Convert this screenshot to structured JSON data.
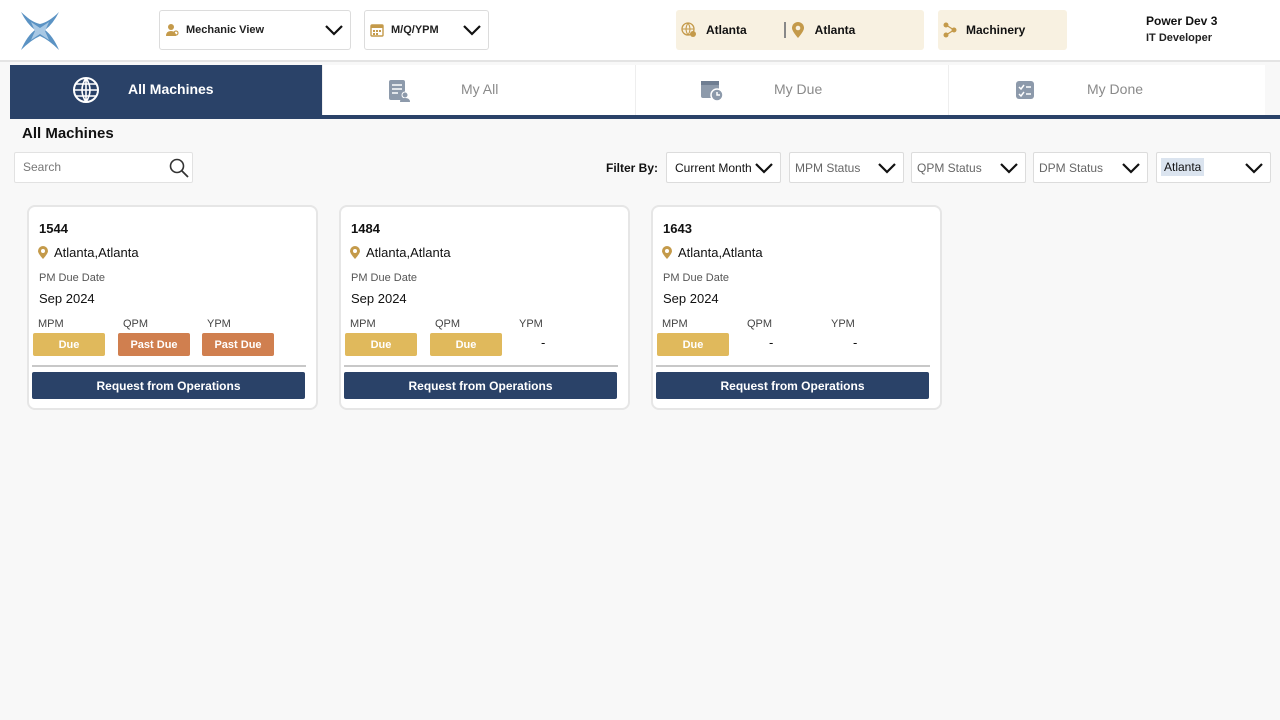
{
  "header": {
    "view_select": "Mechanic View",
    "period_select": "M/Q/YPM",
    "location": {
      "region": "Atlanta",
      "site": "Atlanta"
    },
    "category": "Machinery",
    "user": {
      "name": "Power Dev 3",
      "role": "IT Developer"
    }
  },
  "tabs": [
    {
      "label": "All Machines",
      "icon": "globe-icon",
      "active": true
    },
    {
      "label": "My All",
      "icon": "checklist-user-icon",
      "active": false
    },
    {
      "label": "My Due",
      "icon": "calendar-clock-icon",
      "active": false
    },
    {
      "label": "My Done",
      "icon": "checklist-done-icon",
      "active": false
    }
  ],
  "page_title": "All Machines",
  "search": {
    "placeholder": "Search",
    "value": ""
  },
  "filters": {
    "label": "Filter By:",
    "period": "Current Month",
    "mpm": "MPM Status",
    "qpm": "QPM Status",
    "dpm": "DPM Status",
    "location": "Atlanta"
  },
  "cards": [
    {
      "id": "1544",
      "location": "Atlanta,Atlanta",
      "due_label": "PM Due Date",
      "due_value": "Sep 2024",
      "statuses": [
        {
          "label": "MPM",
          "value": "Due"
        },
        {
          "label": "QPM",
          "value": "Past Due"
        },
        {
          "label": "YPM",
          "value": "Past Due"
        }
      ],
      "action": "Request from Operations"
    },
    {
      "id": "1484",
      "location": "Atlanta,Atlanta",
      "due_label": "PM Due Date",
      "due_value": "Sep 2024",
      "statuses": [
        {
          "label": "MPM",
          "value": "Due"
        },
        {
          "label": "QPM",
          "value": "Due"
        },
        {
          "label": "YPM",
          "value": "-"
        }
      ],
      "action": "Request from Operations"
    },
    {
      "id": "1643",
      "location": "Atlanta,Atlanta",
      "due_label": "PM Due Date",
      "due_value": "Sep 2024",
      "statuses": [
        {
          "label": "MPM",
          "value": "Due"
        },
        {
          "label": "QPM",
          "value": "-"
        },
        {
          "label": "YPM",
          "value": "-"
        }
      ],
      "action": "Request from Operations"
    }
  ],
  "colors": {
    "navy": "#2a4268",
    "due": "#e0b95c",
    "past_due": "#d07f4f",
    "chip_bg": "#f8f1e1",
    "accent_gold": "#c49a4a"
  }
}
